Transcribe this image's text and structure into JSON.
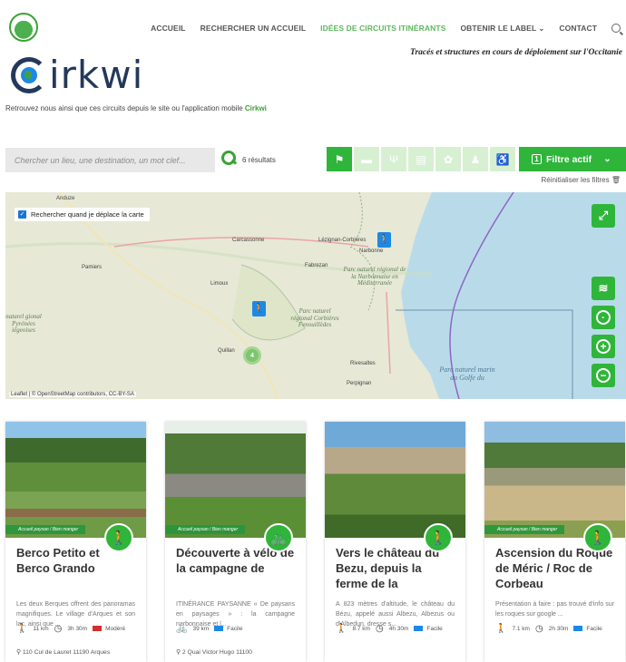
{
  "nav": {
    "items": [
      "ACCUEIL",
      "RECHERCHER UN ACCUEIL",
      "IDÉES DE CIRCUITS ITINÉRANTS",
      "OBTENIR LE LABEL",
      "CONTACT"
    ]
  },
  "tagline": "Tracés et structures en cours de déploiement sur l'Occitanie",
  "brand": {
    "name": "irkwi"
  },
  "subtitle": {
    "text": "Retrouvez nous ainsi que ces circuits depuis le site ou l'application mobile ",
    "highlight": "Cirkwi"
  },
  "search": {
    "placeholder": "Chercher un lieu, une destination, un mot clef...",
    "results": "6 résultats"
  },
  "filter": {
    "label": "Filtre actif",
    "count": "1",
    "reset": "Réinitialiser les filtres"
  },
  "map": {
    "checkbox_label": "Rechercher quand je déplace la carte",
    "attribution": "Leaflet | © OpenStreetMap contributors, CC-BY-SA",
    "cluster_count": "4",
    "towns": [
      "Anduze",
      "Carcassonne",
      "Lézignan-Corbières",
      "Narbonne",
      "Pamiers",
      "Limoux",
      "Quillan",
      "Perpignan",
      "Rivesaltes",
      "Fabrezan"
    ],
    "parks": [
      "Parc naturel régional de la Narbonnaise en Méditerranée",
      "Parc naturel régional Corbières Fenouillèdes",
      "naturel gional Pyrénées iégeoises",
      "Parc naturel marin du Golfe du"
    ]
  },
  "cards": [
    {
      "title": "Berco Petito et Berco Grando",
      "desc": "Les deux Berques offrent des panoramas magnifiques. Le village d'Arques et son lac, ainsi que ...",
      "distance": "11 km",
      "duration": "3h 30m",
      "difficulty": "Modéré",
      "difficulty_color": "#d32f2f",
      "address": "110 Cul de Lauret 11190 Arques",
      "ribbon": "Accueil paysan / Bien manger",
      "activity_icon": "hiker"
    },
    {
      "title": "Découverte à vélo de la campagne de",
      "desc": "ITINÉRANCE PAYSANNE « De paysans en paysages » : la campagne narbonnaise et l...",
      "distance": "39 km",
      "duration": "",
      "difficulty": "Facile",
      "difficulty_color": "#1e88e5",
      "address": "2 Quai Victor Hugo 11100",
      "ribbon": "Accueil paysan / Bien manger",
      "activity_icon": "bike"
    },
    {
      "title": "Vers le château du Bezu, depuis la ferme de la",
      "desc": "A 823 mètres d'altitude, le château du Bézu, appelé aussi Albezu, Albezus ou d'Albedun, dresse s...",
      "distance": "8.7 km",
      "duration": "4h 30m",
      "difficulty": "Facile",
      "difficulty_color": "#1e88e5",
      "address": "",
      "ribbon": "",
      "activity_icon": "hiker"
    },
    {
      "title": "Ascension du Roque de Méric / Roc de Corbeau",
      "desc": "Présentation à faire : pas trouvé d'info sur les roques sur google ...",
      "distance": "7.1 km",
      "duration": "2h 30m",
      "difficulty": "Facile",
      "difficulty_color": "#1e88e5",
      "address": "",
      "ribbon": "Accueil paysan / Bien manger",
      "activity_icon": "hiker"
    }
  ]
}
